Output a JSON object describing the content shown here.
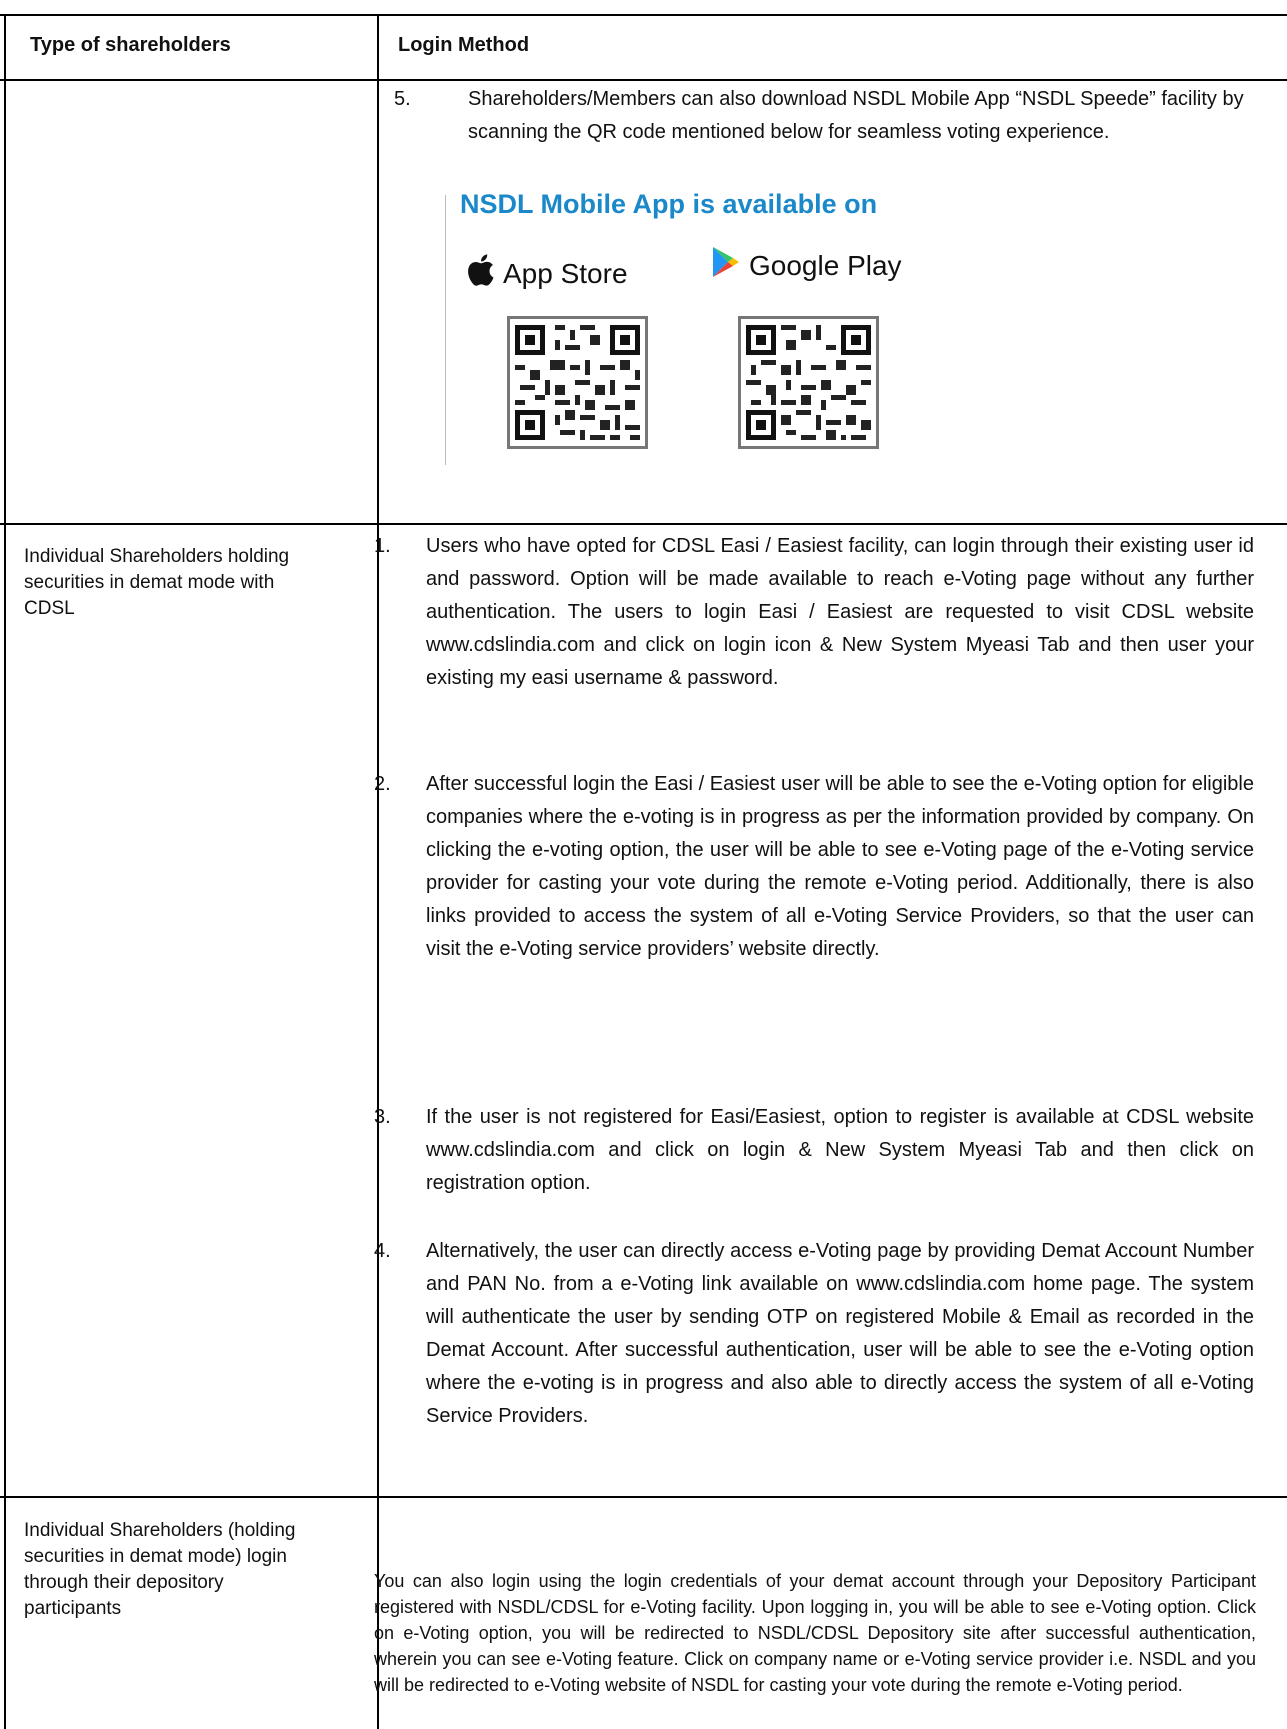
{
  "header": {
    "col1": "Type of shareholders",
    "col2": "Login Method"
  },
  "row_nsdl_app": {
    "item_num": "5.",
    "item_text": "Shareholders/Members can also download NSDL Mobile App “NSDL Speede” facility by scanning the QR code mentioned below for seamless voting experience.",
    "banner_title": "NSDL Mobile App is available on",
    "app_store_label": "App Store",
    "google_play_label": "Google Play",
    "apple_icon": "apple-icon",
    "play_icon": "google-play-icon"
  },
  "row_cdsl": {
    "left_label": "Individual Shareholders holding securities in demat mode with CDSL",
    "items": [
      {
        "num": "1.",
        "text": "Users who have opted for CDSL Easi / Easiest facility, can login through their existing user id and password. Option will be made available to reach e-Voting page without any further authentication. The users to login Easi / Easiest are requested to visit CDSL website www.cdslindia.com and click on login icon & New System Myeasi Tab and then user your existing my easi username & password."
      },
      {
        "num": "2.",
        "text": "After successful login the Easi / Easiest user will be able to see the e-Voting option for eligible companies where the e-voting is in progress as per the information provided by company. On clicking the e-voting option, the user will be able to see e-Voting page of the e-Voting service provider for casting your vote during the remote e-Voting period. Additionally, there is also links provided to access the system of all e-Voting Service Providers, so that the user can visit the e-Voting service providers’ website directly."
      },
      {
        "num": "3.",
        "text": "If the user is not registered for Easi/Easiest, option to register is available at CDSL website www.cdslindia.com and click on login & New System Myeasi Tab and then click on registration option."
      },
      {
        "num": "4.",
        "text": "Alternatively, the user can directly access e-Voting page by providing Demat Account Number and PAN No. from a e-Voting link available on www.cdslindia.com home page. The system will authenticate the user by sending OTP on registered Mobile & Email as recorded in the Demat Account. After successful authentication, user will be able to see the e-Voting option where the e-voting is in progress and also able to directly access the system of all e-Voting Service Providers."
      }
    ]
  },
  "row_dp": {
    "left_label": "Individual Shareholders (holding securities in demat mode) login through their depository participants",
    "text": "You can also login using the login credentials of your demat account through your Depository Participant registered with NSDL/CDSL for e-Voting facility. Upon logging in, you will be able to see e-Voting option. Click on e-Voting option, you will be redirected to NSDL/CDSL Depository site after successful authentication, wherein you can see e-Voting feature. Click on company name or e-Voting service provider i.e. NSDL and you will be redirected to e-Voting website of NSDL for casting your vote during the remote e-Voting period."
  }
}
